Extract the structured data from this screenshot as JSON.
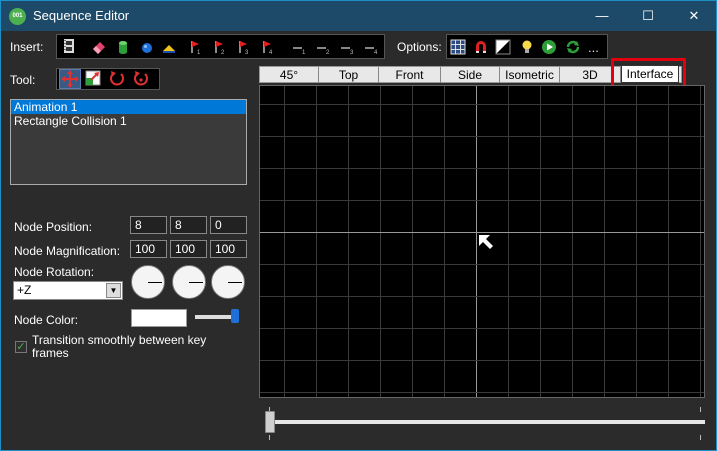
{
  "window": {
    "title": "Sequence Editor",
    "app_icon_text": "001",
    "minimize": "—",
    "maximize": "☐",
    "close": "✕"
  },
  "insert": {
    "label": "Insert:",
    "items": [
      {
        "name": "film-icon"
      },
      {
        "name": "eraser-icon"
      },
      {
        "name": "cylinder-icon"
      },
      {
        "name": "sphere-icon"
      },
      {
        "name": "light-icon"
      },
      {
        "name": "flag-icon",
        "sub": "1"
      },
      {
        "name": "flag-icon",
        "sub": "2"
      },
      {
        "name": "flag-icon",
        "sub": "3"
      },
      {
        "name": "flag-icon",
        "sub": "4"
      },
      {
        "name": "dash-icon",
        "sub": "1"
      },
      {
        "name": "dash-icon",
        "sub": "2"
      },
      {
        "name": "dash-icon",
        "sub": "3"
      },
      {
        "name": "dash-icon",
        "sub": "4"
      }
    ]
  },
  "options": {
    "label": "Options:",
    "more": "..."
  },
  "tool": {
    "label": "Tool:"
  },
  "list": {
    "items": [
      "Animation 1",
      "Rectangle Collision 1"
    ],
    "selected_index": 0
  },
  "node": {
    "position_label": "Node Position:",
    "position": [
      "8",
      "8",
      "0"
    ],
    "magnification_label": "Node Magnification:",
    "magnification": [
      "100",
      "100",
      "100"
    ],
    "rotation_label": "Node Rotation:",
    "rotation_axis": "+Z",
    "color_label": "Node Color:",
    "color_value": "#ffffff",
    "transition_label": "Transition smoothly between key frames",
    "transition_checked": true
  },
  "views": {
    "tabs": [
      "45°",
      "Top",
      "Front",
      "Side",
      "Isometric",
      "3D",
      "Interface"
    ],
    "active": "Interface"
  },
  "colors": {
    "titlebar": "#1d4a68",
    "highlight": "#e3000f",
    "selection": "#0078d7"
  }
}
